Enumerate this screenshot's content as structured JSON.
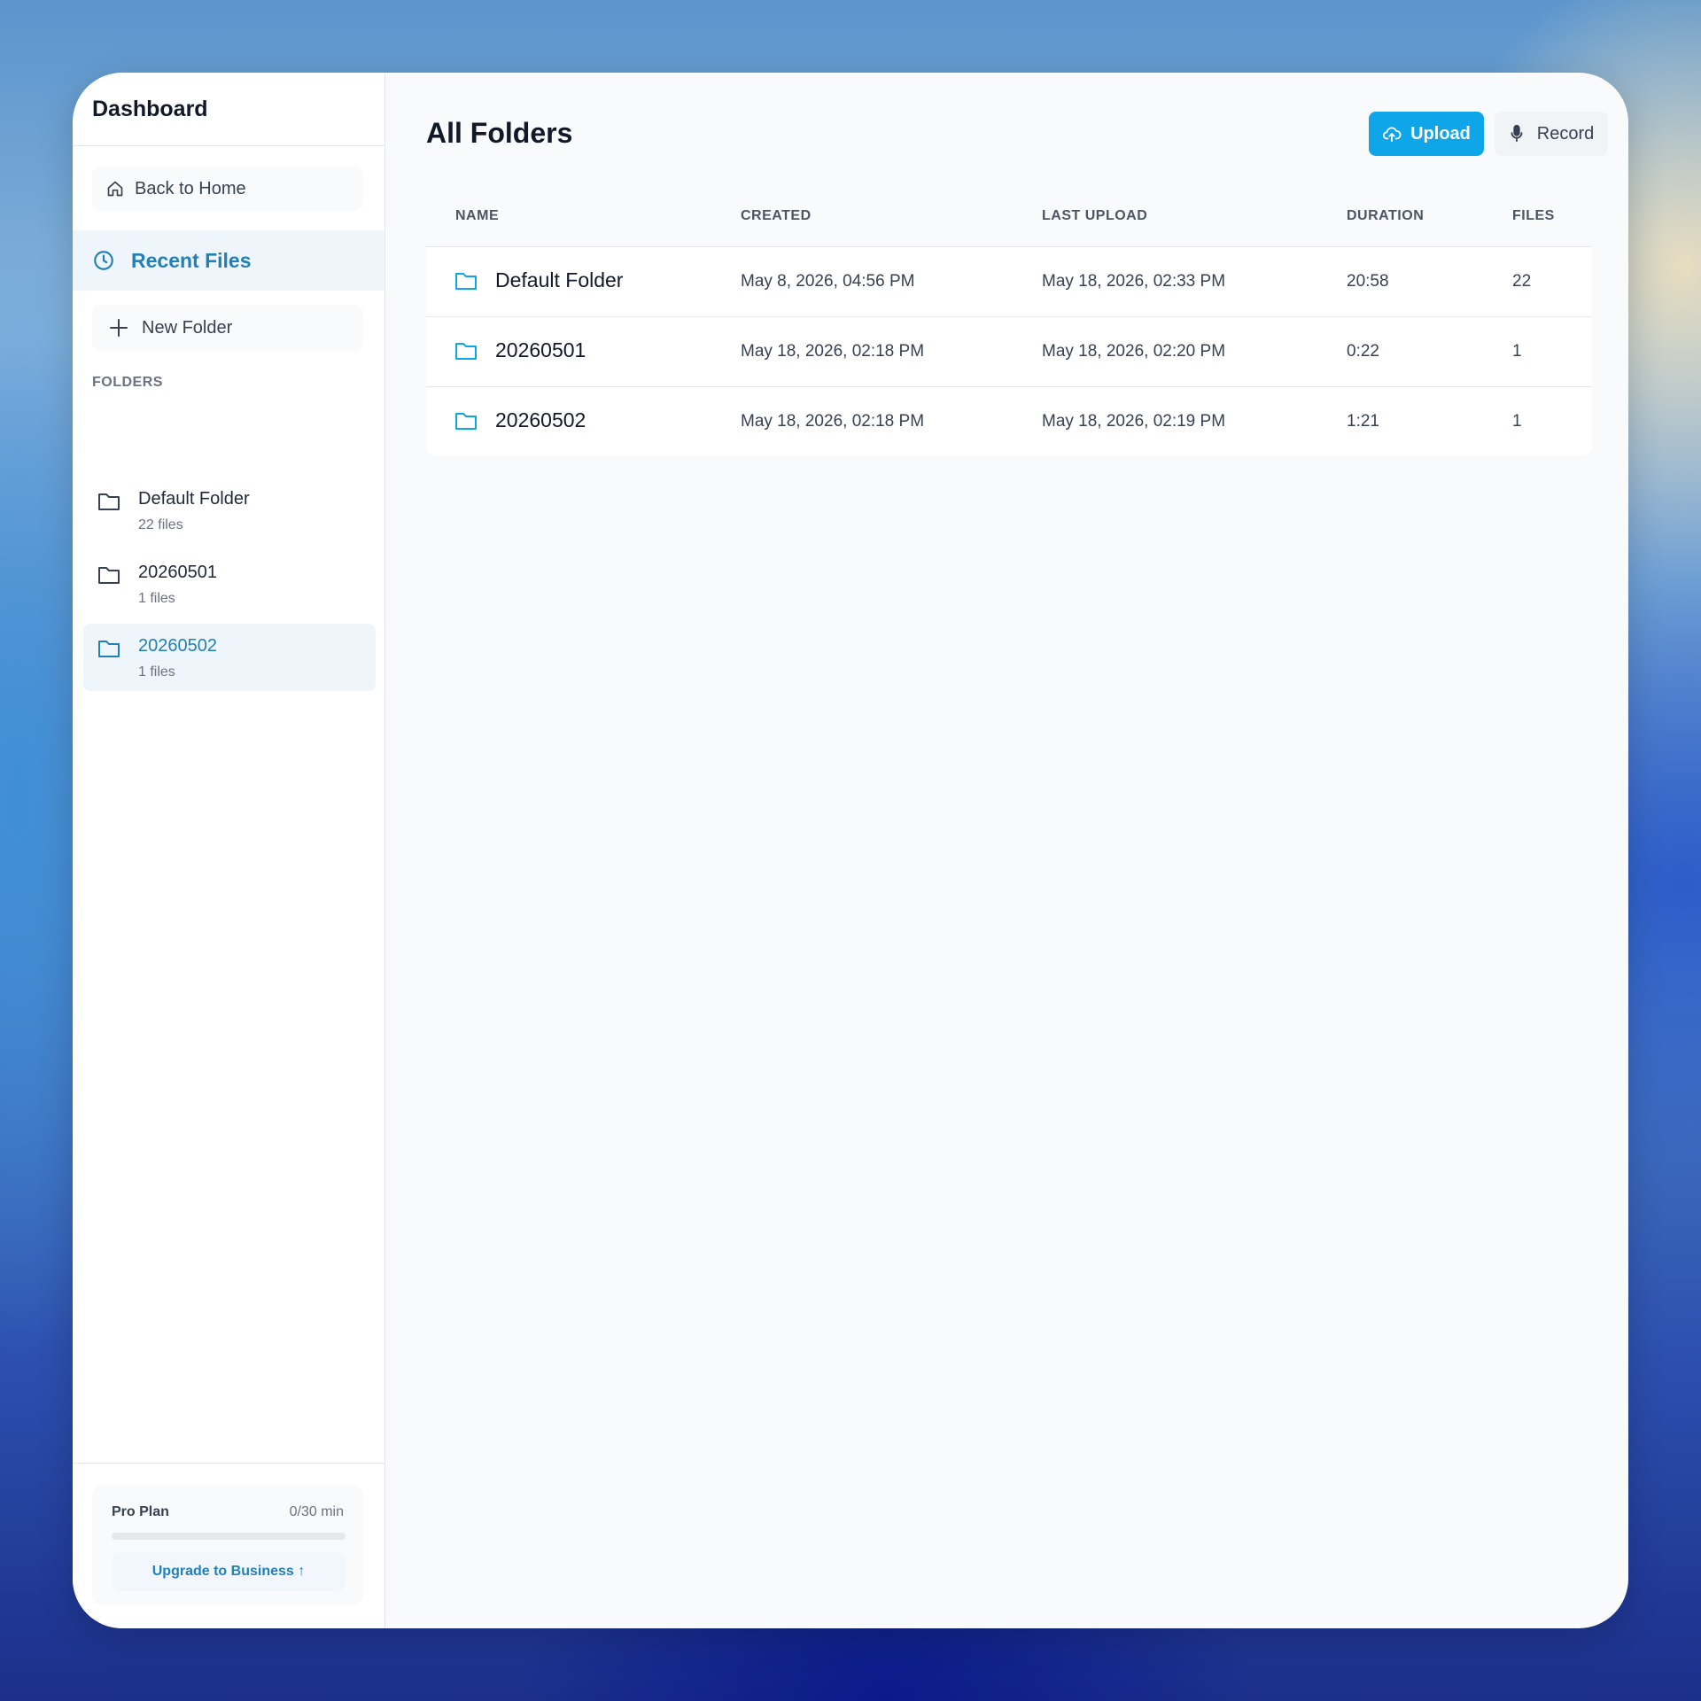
{
  "sidebar": {
    "title": "Dashboard",
    "back_label": "Back to Home",
    "recent_label": "Recent Files",
    "new_folder_label": "New Folder",
    "folders_heading": "FOLDERS",
    "folders": [
      {
        "name": "Default Folder",
        "count": "22 files"
      },
      {
        "name": "20260501",
        "count": "1 files"
      },
      {
        "name": "20260502",
        "count": "1 files"
      }
    ],
    "plan": {
      "name": "Pro Plan",
      "usage": "0/30 min",
      "progress_percent": 0,
      "upgrade_label": "Upgrade to Business ↑"
    }
  },
  "main": {
    "title": "All Folders",
    "upload_label": "Upload",
    "record_label": "Record",
    "table": {
      "headers": {
        "name": "NAME",
        "created": "CREATED",
        "last_upload": "LAST UPLOAD",
        "duration": "DURATION",
        "files": "FILES"
      },
      "rows": [
        {
          "name": "Default Folder",
          "created": "May 8, 2026, 04:56 PM",
          "last_upload": "May 18, 2026, 02:33 PM",
          "duration": "20:58",
          "files": "22"
        },
        {
          "name": "20260501",
          "created": "May 18, 2026, 02:18 PM",
          "last_upload": "May 18, 2026, 02:20 PM",
          "duration": "0:22",
          "files": "1"
        },
        {
          "name": "20260502",
          "created": "May 18, 2026, 02:18 PM",
          "last_upload": "May 18, 2026, 02:19 PM",
          "duration": "1:21",
          "files": "1"
        }
      ]
    }
  },
  "colors": {
    "accent": "#0ea5e9",
    "active_text": "#2280b8",
    "active_bg": "#eff6fb"
  }
}
